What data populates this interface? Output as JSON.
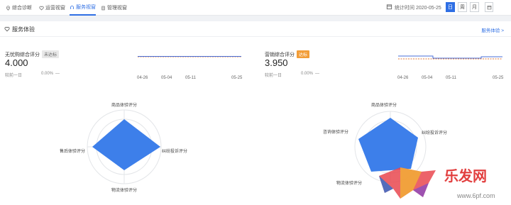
{
  "nav": {
    "tabs": [
      {
        "label": "综合诊断",
        "icon": "location-pin-icon"
      },
      {
        "label": "运营视窗",
        "icon": "heart-icon"
      },
      {
        "label": "服务视窗",
        "icon": "headset-icon",
        "active": true
      },
      {
        "label": "管理视窗",
        "icon": "document-icon"
      }
    ],
    "stat_time": "统计时间 2020-05-25",
    "periods": [
      "日",
      "周",
      "月"
    ],
    "active_period": "日"
  },
  "section": {
    "title": "服务体验",
    "more_link": "服务体验 >"
  },
  "left_panel": {
    "label": "无忧购综合评分",
    "badge": "未达标",
    "score": "4.000",
    "compare_label": "较前一日",
    "compare_value": "0.00%",
    "compare_trend": "—",
    "x_ticks": [
      "04-26",
      "05-04",
      "05-11",
      "05-25"
    ]
  },
  "right_panel": {
    "label": "营销综合评分",
    "badge": "达标",
    "score": "3.950",
    "compare_label": "较前一日",
    "compare_value": "0.00%",
    "compare_trend": "—",
    "x_ticks": [
      "04-26",
      "05-04",
      "05-11",
      "05-25"
    ]
  },
  "left_radar": {
    "labels": [
      "商品体验评分",
      "纠纷投诉评分",
      "物流体验评分",
      "售后体验评分"
    ]
  },
  "right_radar": {
    "labels": [
      "商品体验评分",
      "纠纷投诉评分",
      "物流体验评分",
      "咨询体验评分"
    ]
  },
  "watermark": {
    "text1": "乐发网",
    "text2": "www.6pf.com"
  },
  "colors": {
    "accent": "#2f6fe4",
    "radar_fill": "#3d7fea",
    "badge_warn": "#f29d38",
    "line_target": "#e07a3a"
  }
}
